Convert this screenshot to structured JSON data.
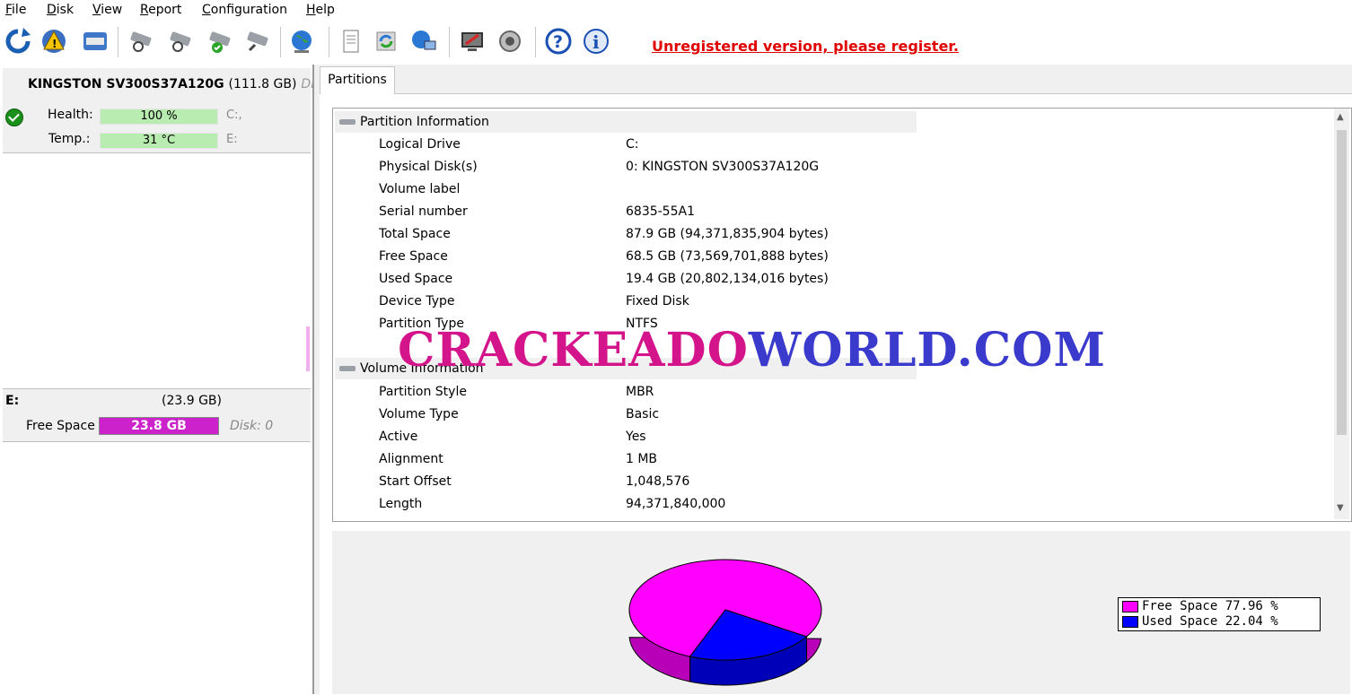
{
  "menu": [
    "File",
    "Disk",
    "View",
    "Report",
    "Configuration",
    "Help"
  ],
  "toolbar": {
    "icons": [
      "refresh-icon",
      "warning-icon",
      "disk-icon",
      "disk-tool-1-icon",
      "disk-tool-2-icon",
      "disk-check-icon",
      "disk-search-icon",
      "globe-icon",
      "document-icon",
      "sync-icon",
      "network-icon",
      "monitor-icon",
      "speaker-icon",
      "help-icon",
      "info-icon"
    ],
    "register_text": "Unregistered version, please register."
  },
  "disk": {
    "name": "KINGSTON SV300S37A120G",
    "size": "(111.8 GB)",
    "suffix": "Dis",
    "health_label": "Health:",
    "health_value": "100 %",
    "health_drive": "C:,",
    "temp_label": "Temp.:",
    "temp_value": "31 °C",
    "temp_drive": "E:"
  },
  "partition_card": {
    "drive": "E:",
    "size": "(23.9 GB)",
    "free_label": "Free Space",
    "free_value": "23.8 GB",
    "disk_ref": "Disk: 0"
  },
  "tabs": [
    "Partitions"
  ],
  "partition_info": {
    "title": "Partition Information",
    "rows": [
      {
        "label": "Logical Drive",
        "value": "C:"
      },
      {
        "label": "Physical Disk(s)",
        "value": "0: KINGSTON SV300S37A120G"
      },
      {
        "label": "Volume label",
        "value": ""
      },
      {
        "label": "Serial number",
        "value": "6835-55A1"
      },
      {
        "label": "Total Space",
        "value": "87.9 GB (94,371,835,904 bytes)"
      },
      {
        "label": "Free Space",
        "value": "68.5 GB (73,569,701,888 bytes)"
      },
      {
        "label": "Used Space",
        "value": "19.4 GB (20,802,134,016 bytes)"
      },
      {
        "label": "Device Type",
        "value": "Fixed Disk"
      },
      {
        "label": "Partition Type",
        "value": "NTFS"
      }
    ]
  },
  "volume_info": {
    "title": "Volume Information",
    "rows": [
      {
        "label": "Partition Style",
        "value": "MBR"
      },
      {
        "label": "Volume Type",
        "value": "Basic"
      },
      {
        "label": "Active",
        "value": "Yes"
      },
      {
        "label": "Alignment",
        "value": "1 MB"
      },
      {
        "label": "Start Offset",
        "value": "1,048,576"
      },
      {
        "label": "Length",
        "value": "94,371,840,000"
      }
    ]
  },
  "legend": [
    {
      "text": "Free Space 77.96 %",
      "color": "#ff00ff"
    },
    {
      "text": "Used Space 22.04 %",
      "color": "#0000ff"
    }
  ],
  "chart_data": {
    "type": "pie",
    "categories": [
      "Free Space",
      "Used Space"
    ],
    "values": [
      77.96,
      22.04
    ],
    "colors": [
      "#ff00ff",
      "#0000ff"
    ]
  },
  "watermark": {
    "part1": "CRACKEADO",
    "part2": "WORLD.COM"
  }
}
